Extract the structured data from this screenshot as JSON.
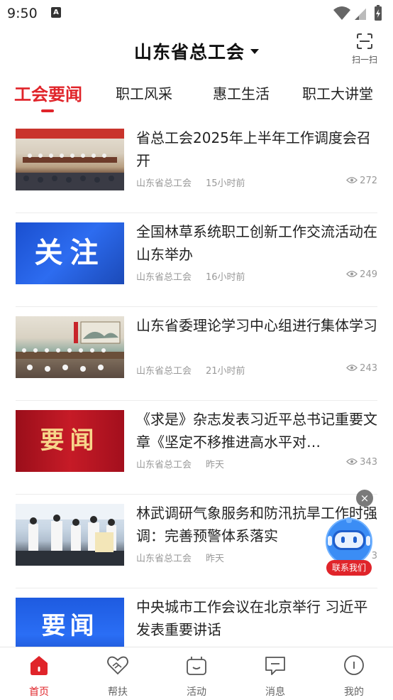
{
  "status_bar": {
    "time": "9:50",
    "notification_badge": "A"
  },
  "header": {
    "title": "山东省总工会",
    "scan_label": "扫一扫"
  },
  "tabs": [
    {
      "label": "工会要闻",
      "active": true
    },
    {
      "label": "职工风采",
      "active": false
    },
    {
      "label": "惠工生活",
      "active": false
    },
    {
      "label": "职工大讲堂",
      "active": false
    }
  ],
  "news": [
    {
      "title": "省总工会2025年上半年工作调度会召开",
      "source": "山东省总工会",
      "time": "15小时前",
      "views": "272",
      "thumb_text": ""
    },
    {
      "title": "全国林草系统职工创新工作交流活动在山东举办",
      "source": "山东省总工会",
      "time": "16小时前",
      "views": "249",
      "thumb_text": "关注"
    },
    {
      "title": "山东省委理论学习中心组进行集体学习",
      "source": "山东省总工会",
      "time": "21小时前",
      "views": "243",
      "thumb_text": ""
    },
    {
      "title": "《求是》杂志发表习近平总书记重要文章《坚定不移推进高水平对…",
      "source": "山东省总工会",
      "time": "昨天",
      "views": "343",
      "thumb_text": "要闻"
    },
    {
      "title": "林武调研气象服务和防汛抗旱工作时强调：完善预警体系落实",
      "source": "山东省总工会",
      "time": "昨天",
      "views": "3",
      "thumb_text": ""
    },
    {
      "title": "中央城市工作会议在北京举行 习近平发表重要讲话",
      "source": "",
      "time": "",
      "views": "",
      "thumb_text": "要闻"
    }
  ],
  "float_widget": {
    "close_symbol": "×",
    "label": "联系我们"
  },
  "bottom_nav": [
    {
      "label": "首页",
      "icon": "home-icon",
      "active": true
    },
    {
      "label": "帮扶",
      "icon": "heart-hand-icon",
      "active": false
    },
    {
      "label": "活动",
      "icon": "activity-icon",
      "active": false
    },
    {
      "label": "消息",
      "icon": "message-icon",
      "active": false
    },
    {
      "label": "我的",
      "icon": "profile-icon",
      "active": false
    }
  ],
  "colors": {
    "accent": "#e0242a",
    "text": "#222222",
    "meta": "#999999"
  }
}
